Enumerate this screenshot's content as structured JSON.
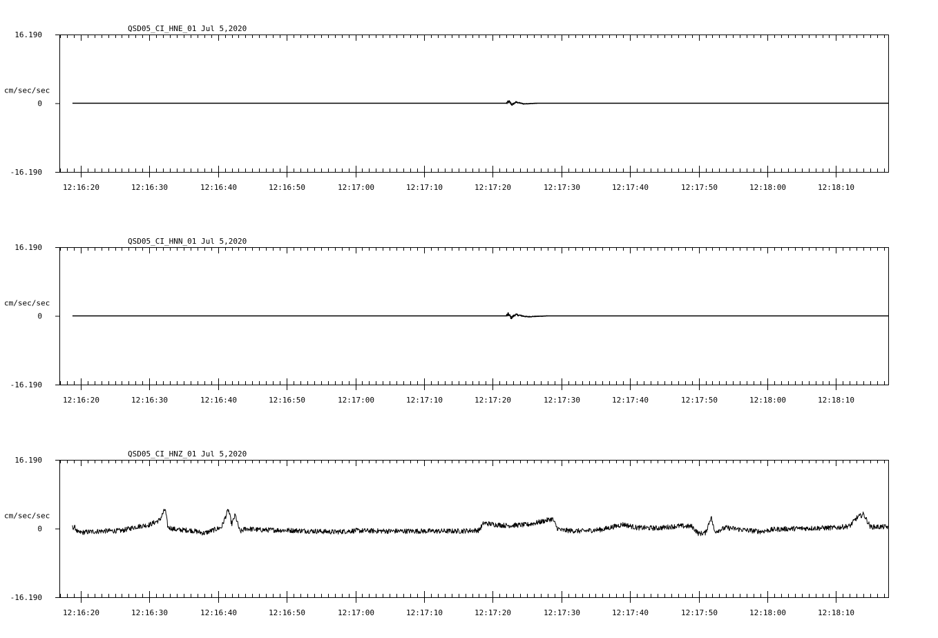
{
  "chart_data": [
    {
      "type": "line",
      "title": "QSD05_CI_HNE_01  Jul 5,2020",
      "ylabel": "cm/sec/sec",
      "ylim": [
        -16.19,
        16.19
      ],
      "ytick_labels": [
        "16.190",
        "0",
        "-16.190"
      ],
      "xlim_seconds_after_12_16_00": [
        16.9,
        137.6
      ],
      "xtick_labels": [
        "12:16:20",
        "12:16:30",
        "12:16:40",
        "12:16:50",
        "12:17:00",
        "12:17:10",
        "12:17:20",
        "12:17:30",
        "12:17:40",
        "12:17:50",
        "12:18:00",
        "12:18:10"
      ],
      "trace_start_time": "12:16:18.8",
      "trace_end_time": "12:18:17.6",
      "event_burst": {
        "start_time": "12:17:22.0",
        "end_time": "12:17:26.5",
        "peak_amplitude": 0.4
      },
      "trace_points": [
        [
          "12:16:18.8",
          0
        ],
        [
          "12:17:22.0",
          0
        ],
        [
          "12:17:22.4",
          0.35
        ],
        [
          "12:17:22.8",
          -0.35
        ],
        [
          "12:17:23.4",
          0.25
        ],
        [
          "12:17:24.5",
          -0.15
        ],
        [
          "12:17:26.5",
          0
        ],
        [
          "12:18:17.6",
          0
        ]
      ]
    },
    {
      "type": "line",
      "title": "QSD05_CI_HNN_01  Jul 5,2020",
      "ylabel": "cm/sec/sec",
      "ylim": [
        -16.19,
        16.19
      ],
      "ytick_labels": [
        "16.190",
        "0",
        "-16.190"
      ],
      "xlim_seconds_after_12_16_00": [
        16.9,
        137.6
      ],
      "xtick_labels": [
        "12:16:20",
        "12:16:30",
        "12:16:40",
        "12:16:50",
        "12:17:00",
        "12:17:10",
        "12:17:20",
        "12:17:30",
        "12:17:40",
        "12:17:50",
        "12:18:00",
        "12:18:10"
      ],
      "trace_start_time": "12:16:18.8",
      "trace_end_time": "12:18:17.6",
      "event_burst": {
        "start_time": "12:17:22.0",
        "end_time": "12:17:28.0",
        "peak_amplitude": 0.45
      },
      "trace_points": [
        [
          "12:16:18.8",
          0
        ],
        [
          "12:17:22.0",
          0
        ],
        [
          "12:17:22.3",
          0.4
        ],
        [
          "12:17:22.7",
          -0.45
        ],
        [
          "12:17:23.3",
          0.3
        ],
        [
          "12:17:25.0",
          -0.2
        ],
        [
          "12:17:28.0",
          0
        ],
        [
          "12:18:17.6",
          0
        ]
      ]
    },
    {
      "type": "line",
      "title": "QSD05_CI_HNZ_01  Jul 5,2020",
      "ylabel": "cm/sec/sec",
      "ylim": [
        -16.19,
        16.19
      ],
      "ytick_labels": [
        "16.190",
        "0",
        "-16.190"
      ],
      "xlim_seconds_after_12_16_00": [
        16.9,
        137.6
      ],
      "xtick_labels": [
        "12:16:20",
        "12:16:30",
        "12:16:40",
        "12:16:50",
        "12:17:00",
        "12:17:10",
        "12:17:20",
        "12:17:30",
        "12:17:40",
        "12:17:50",
        "12:18:00",
        "12:18:10"
      ],
      "trace_start_time": "12:16:18.8",
      "trace_end_time": "12:18:17.6",
      "noise_level": 0.6,
      "trace_points": [
        [
          "12:16:18.8",
          0.3
        ],
        [
          "12:16:19.2",
          0.2
        ],
        [
          "12:16:19.6",
          -1.0
        ],
        [
          "12:16:21.0",
          -0.8
        ],
        [
          "12:16:23.0",
          -0.6
        ],
        [
          "12:16:26.0",
          -0.5
        ],
        [
          "12:16:28.0",
          0.4
        ],
        [
          "12:16:30.0",
          0.9
        ],
        [
          "12:16:31.5",
          2.0
        ],
        [
          "12:16:32.3",
          4.6
        ],
        [
          "12:16:32.7",
          0.3
        ],
        [
          "12:16:34.0",
          -0.3
        ],
        [
          "12:16:36.0",
          -0.4
        ],
        [
          "12:16:38.0",
          -1.1
        ],
        [
          "12:16:40.5",
          0.3
        ],
        [
          "12:16:41.5",
          4.5
        ],
        [
          "12:16:42.0",
          1.0
        ],
        [
          "12:16:42.5",
          3.2
        ],
        [
          "12:16:43.2",
          -0.8
        ],
        [
          "12:16:44.0",
          0.0
        ],
        [
          "12:16:46.0",
          -0.3
        ],
        [
          "12:16:50.0",
          -0.4
        ],
        [
          "12:16:54.0",
          -0.6
        ],
        [
          "12:16:57.0",
          -0.8
        ],
        [
          "12:17:00.0",
          -0.5
        ],
        [
          "12:17:05.0",
          -0.6
        ],
        [
          "12:17:10.0",
          -0.6
        ],
        [
          "12:17:15.0",
          -0.6
        ],
        [
          "12:17:18.0",
          -0.4
        ],
        [
          "12:17:18.7",
          1.3
        ],
        [
          "12:17:20.0",
          1.0
        ],
        [
          "12:17:22.0",
          0.7
        ],
        [
          "12:17:25.0",
          0.9
        ],
        [
          "12:17:27.0",
          1.6
        ],
        [
          "12:17:28.7",
          2.3
        ],
        [
          "12:17:29.4",
          0.1
        ],
        [
          "12:17:30.0",
          -0.4
        ],
        [
          "12:17:33.0",
          -0.6
        ],
        [
          "12:17:36.0",
          -0.2
        ],
        [
          "12:17:39.0",
          1.0
        ],
        [
          "12:17:41.0",
          0.2
        ],
        [
          "12:17:44.0",
          0.1
        ],
        [
          "12:17:47.0",
          0.6
        ],
        [
          "12:17:49.0",
          0.5
        ],
        [
          "12:17:50.0",
          -1.2
        ],
        [
          "12:17:51.0",
          -1.0
        ],
        [
          "12:17:51.8",
          2.8
        ],
        [
          "12:17:52.3",
          -0.7
        ],
        [
          "12:17:54.0",
          0.2
        ],
        [
          "12:17:57.0",
          -0.4
        ],
        [
          "12:17:59.0",
          -0.7
        ],
        [
          "12:18:01.0",
          -0.2
        ],
        [
          "12:18:04.0",
          0.0
        ],
        [
          "12:18:07.0",
          0.1
        ],
        [
          "12:18:10.0",
          0.2
        ],
        [
          "12:18:12.0",
          0.6
        ],
        [
          "12:18:13.0",
          2.5
        ],
        [
          "12:18:14.0",
          3.4
        ],
        [
          "12:18:15.0",
          0.4
        ],
        [
          "12:18:17.6",
          0.4
        ]
      ]
    }
  ]
}
